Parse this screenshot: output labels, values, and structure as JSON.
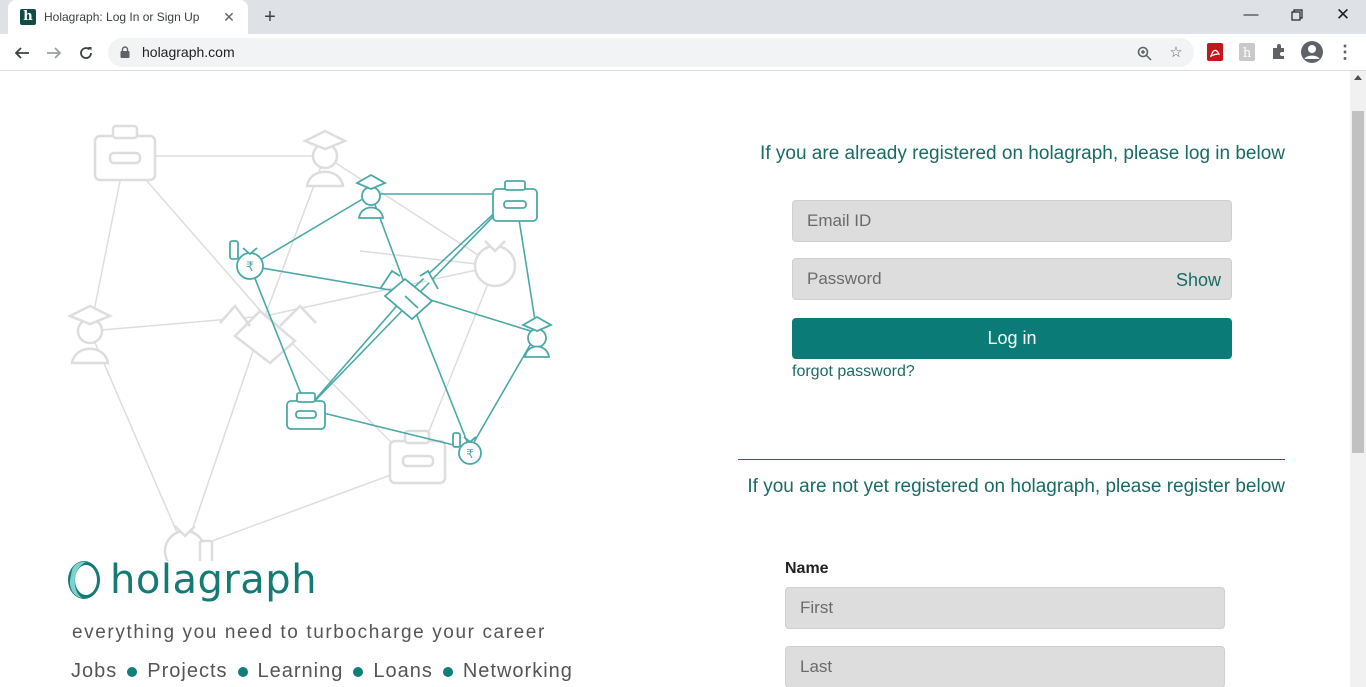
{
  "browser": {
    "tab_title": "Holagraph: Log In or Sign Up",
    "favicon_letter": "h",
    "url": "holagraph.com"
  },
  "brand": {
    "name": "holagraph",
    "tagline": "everything you need to turbocharge your career",
    "services": [
      "Jobs",
      "Projects",
      "Learning",
      "Loans",
      "Networking"
    ]
  },
  "login": {
    "heading": "If you are already registered on holagraph, please log in below",
    "email_placeholder": "Email ID",
    "password_placeholder": "Password",
    "show_label": "Show",
    "login_button": "Log in",
    "forgot_link": "forgot password?"
  },
  "register": {
    "heading": "If you are not yet registered on holagraph, please register below",
    "name_label": "Name",
    "first_placeholder": "First",
    "last_placeholder": "Last"
  },
  "colors": {
    "brand_teal": "#0a7b77",
    "heading_teal": "#1a6b63",
    "network_line": "#4aa9a6",
    "faded_icon": "#dddddd"
  }
}
